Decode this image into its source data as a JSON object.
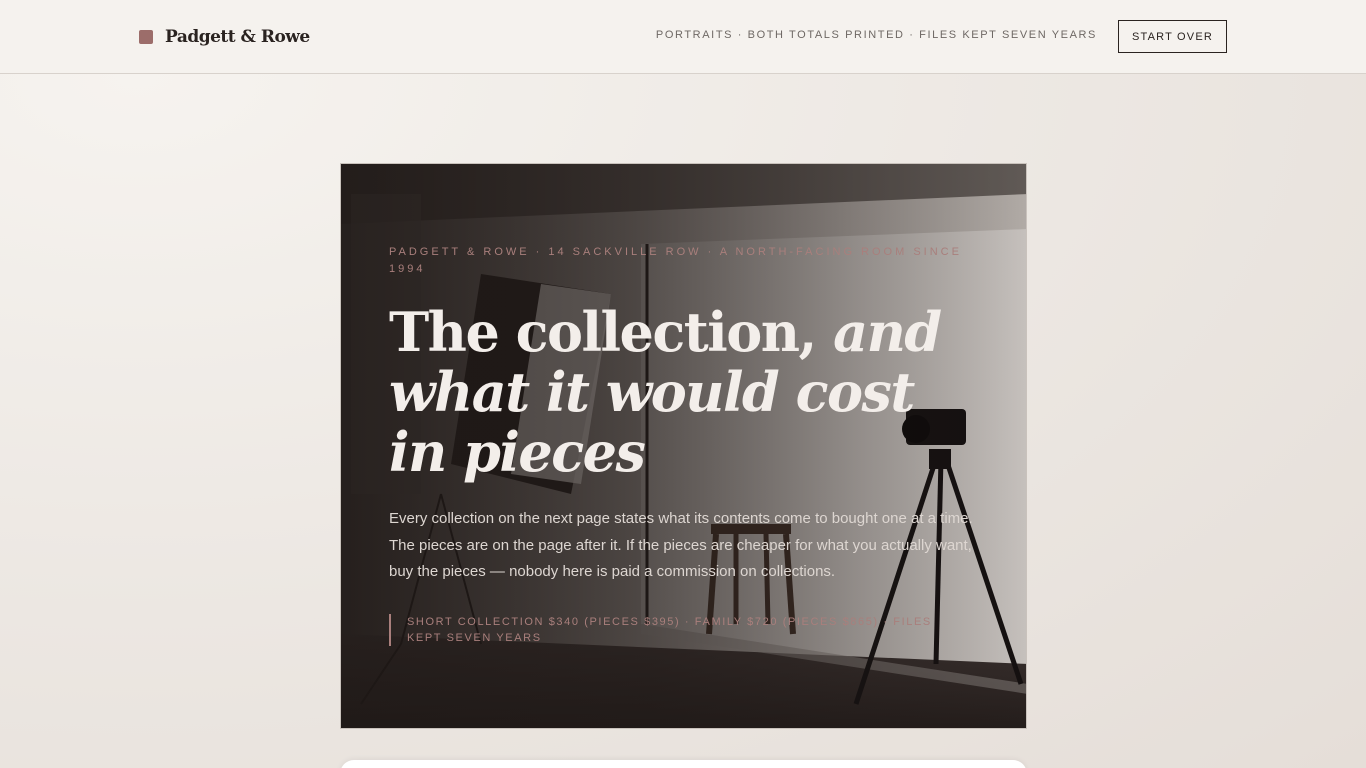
{
  "header": {
    "brand": "Padgett & Rowe",
    "meta": "PORTRAITS · BOTH TOTALS PRINTED · FILES KEPT SEVEN YEARS",
    "start_over": "START OVER"
  },
  "hero": {
    "eyebrow": "PADGETT & ROWE · 14 SACKVILLE ROW · A NORTH-FACING ROOM SINCE 1994",
    "headline_plain": "The collection, ",
    "headline_italic": "and what it would cost in pieces",
    "lede": "Every collection on the next page states what its contents come to bought one at a time. The pieces are on the page after it. If the pieces are cheaper for what you actually want, buy the pieces — nobody here is paid a commission on collections.",
    "note": "SHORT COLLECTION $340 (PIECES $395) · FAMILY $720 (PIECES $865) · FILES KEPT SEVEN YEARS"
  },
  "colors": {
    "accent": "#9c6d6a",
    "accent_text": "#a97f7c",
    "ink": "#2a2320",
    "background": "#f5f2ee"
  },
  "icons": {
    "brand_mark": "square-mark"
  }
}
